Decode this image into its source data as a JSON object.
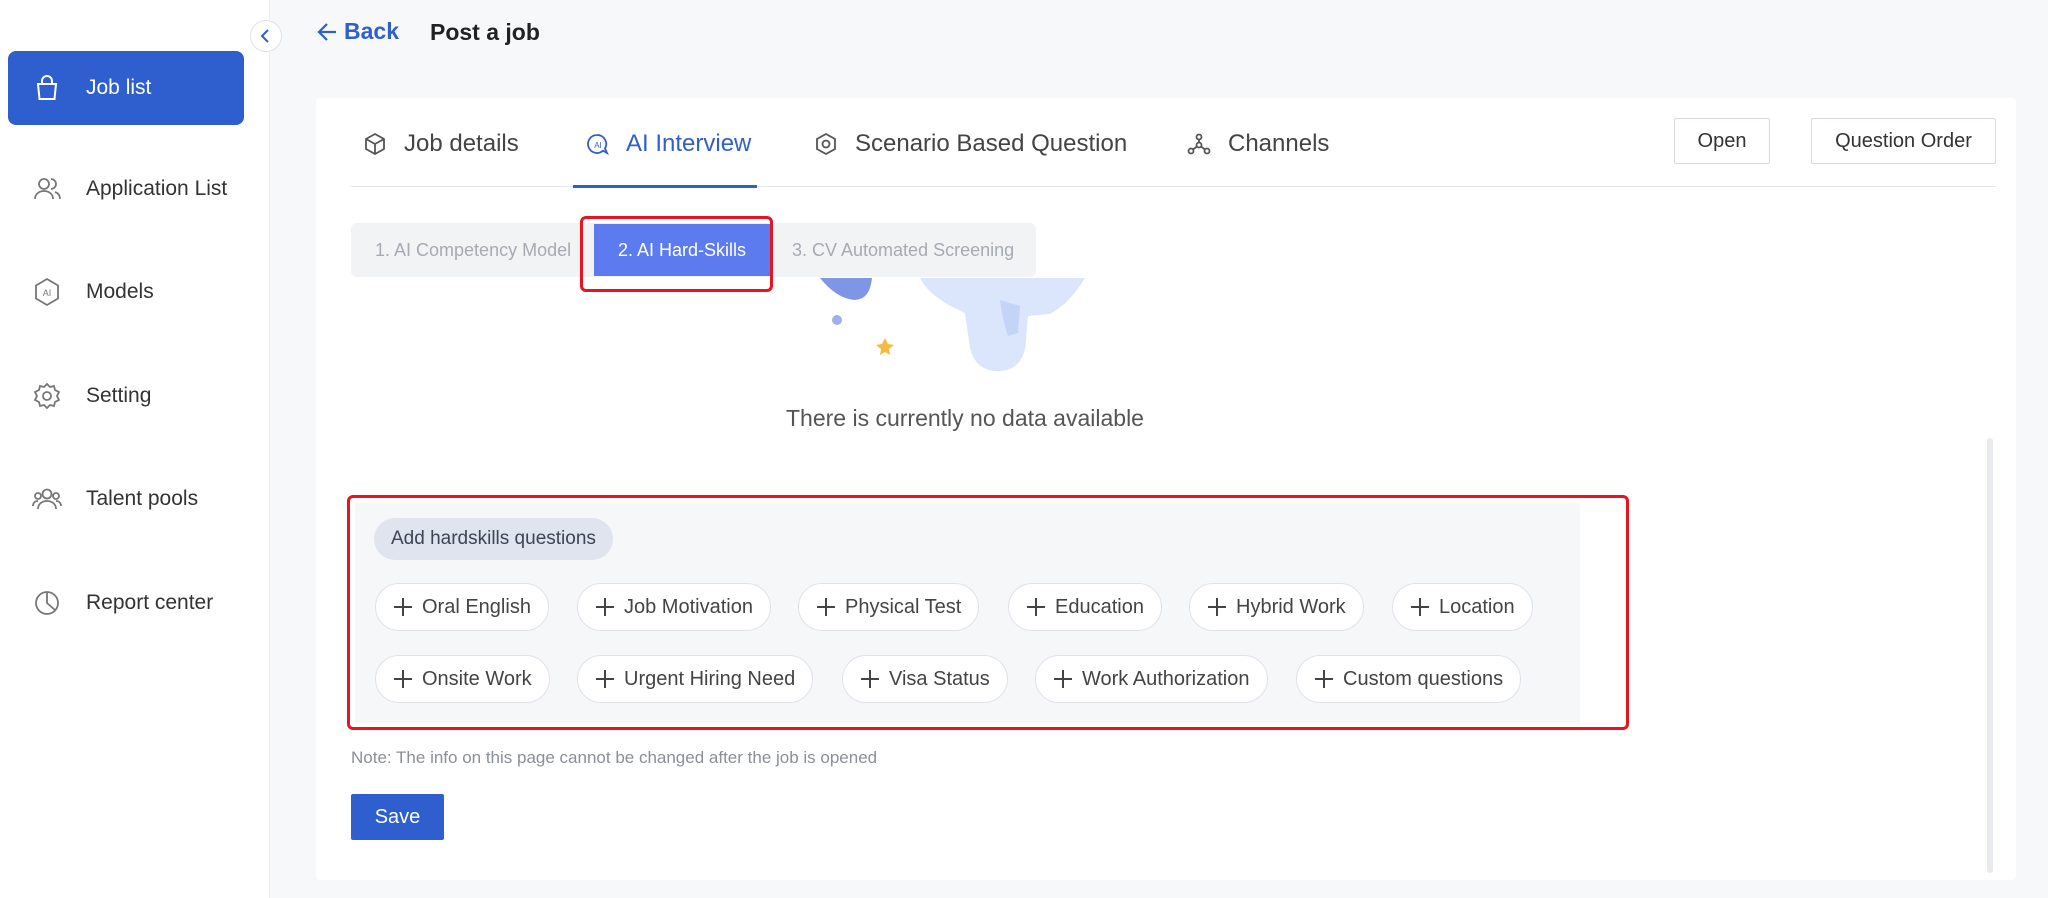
{
  "sidebar": {
    "items": [
      {
        "label": "Job list",
        "icon": "bag-icon",
        "active": true
      },
      {
        "label": "Application List",
        "icon": "users-icon"
      },
      {
        "label": "Models",
        "icon": "ai-hexagon-icon"
      },
      {
        "label": "Setting",
        "icon": "gear-icon"
      },
      {
        "label": "Talent pools",
        "icon": "people-group-icon"
      },
      {
        "label": "Report center",
        "icon": "pie-chart-icon"
      }
    ]
  },
  "header": {
    "back_label": "Back",
    "title": "Post a job"
  },
  "tabs": [
    {
      "label": "Job details",
      "icon": "cube-icon"
    },
    {
      "label": "AI Interview",
      "icon": "ai-bubble-icon",
      "active": true
    },
    {
      "label": "Scenario Based Question",
      "icon": "hex-settings-icon"
    },
    {
      "label": "Channels",
      "icon": "network-icon"
    }
  ],
  "actions": {
    "open_label": "Open",
    "question_order_label": "Question Order"
  },
  "steps": [
    {
      "label": "1. AI Competency Model"
    },
    {
      "label": "2. AI Hard-Skills",
      "active": true
    },
    {
      "label": "3. CV Automated Screening"
    }
  ],
  "empty_state": {
    "text": "There is currently no data available"
  },
  "hardskills": {
    "title": "Add hardskills questions",
    "chips": [
      "Oral English",
      "Job Motivation",
      "Physical Test",
      "Education",
      "Hybrid Work",
      "Location",
      "Onsite Work",
      "Urgent Hiring Need",
      "Visa Status",
      "Work Authorization",
      "Custom questions"
    ]
  },
  "note": "Note: The info on this page cannot be changed after the job is opened",
  "save_label": "Save",
  "colors": {
    "primary": "#2f5fcf",
    "step_active": "#5b7bef",
    "highlight": "#e8141f"
  }
}
